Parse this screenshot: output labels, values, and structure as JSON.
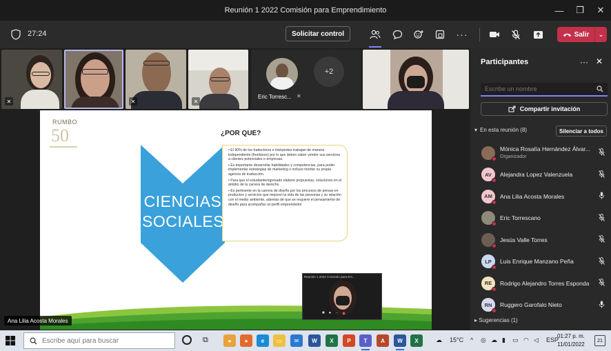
{
  "window": {
    "title": "Reunión 1 2022 Comisión para Emprendimiento",
    "minimize": "—",
    "maximize": "❐",
    "close": "✕"
  },
  "toolbar": {
    "timer": "27:24",
    "request_control": "Solicitar control",
    "leave_label": "Salir",
    "leave_caret": "⌄",
    "accent": "#7f85f5",
    "leave_color": "#c4314b"
  },
  "videos": {
    "avatar_name": "Eric Torresc...",
    "overflow_count": "+2"
  },
  "slide": {
    "logo_word": "RUMBO",
    "logo_number": "50",
    "heading": "¿POR QUE?",
    "chevron_text_line1": "CIENCIAS",
    "chevron_text_line2": "SOCIALES",
    "chevron_color": "#3aa1db",
    "bullets": [
      "El 90% de los traductores e intérpretes trabajan de manera independiente (freelance) por lo que deben saber vender sus servicios a clientes potenciales o empresas.",
      "Es importante desarrollar habilidades y competencias, para poder implementar estrategias de marketing o incluso montar su propia agencia de traducción.",
      "Para que el estudiante/egresado elabore propuestas, soluciones en el ámbito de la carrera de derecho",
      "Es pertinente en la carrera de diseño por los procesos de pensar en productos y servicios que mejoren la vida de las personas y su relación con el medio ambiente, además de que se requiere el pensamiento de diseño para acompañar un perfil emprendedor"
    ],
    "selfview_label": "Reunión 1 2022 Comisión para Em..."
  },
  "presenter_name": "Ana Lilia Acosta Morales",
  "panel": {
    "title": "Participantes",
    "more": "···",
    "close": "✕",
    "search_placeholder": "Escribe un nombre",
    "share_invite": "Compartir invitación",
    "section_label": "En esta reunión (8)",
    "mute_all": "Silenciar a todos",
    "participants": [
      {
        "name": "Mónica Rosalía Hernández Álvar...",
        "role": "Organizador",
        "initials": "",
        "photo": true,
        "color": "#8a6b55",
        "mic": "muted"
      },
      {
        "name": "Alejandra Lopez Valenzuela",
        "role": "",
        "initials": "AV",
        "photo": false,
        "color": "#f3c6cf",
        "mic": "muted"
      },
      {
        "name": "Ana Lilia Acosta Morales",
        "role": "",
        "initials": "AM",
        "photo": false,
        "color": "#f3c6cf",
        "mic": "on"
      },
      {
        "name": "Eric Torrescano",
        "role": "",
        "initials": "",
        "photo": true,
        "color": "#8f8a7a",
        "mic": "muted"
      },
      {
        "name": "Jesús Valle Torres",
        "role": "",
        "initials": "",
        "photo": true,
        "color": "#6b5f55",
        "mic": "muted"
      },
      {
        "name": "Luis Enrique Manzano Peña",
        "role": "",
        "initials": "LP",
        "photo": false,
        "color": "#c9d9f2",
        "mic": "muted"
      },
      {
        "name": "Rodrigo Alejandro Torres Esponda",
        "role": "",
        "initials": "RE",
        "photo": false,
        "color": "#f3e3c0",
        "mic": "muted"
      },
      {
        "name": "Ruggero Garofalo Nieto",
        "role": "",
        "initials": "RN",
        "photo": false,
        "color": "#d6d9ee",
        "mic": "on"
      }
    ],
    "suggestions": "Sugerencias (1)"
  },
  "taskbar": {
    "search_placeholder": "Escribe aquí para buscar",
    "weather": "15°C",
    "language": "ESP",
    "time": "01:27 p. m.",
    "date": "11/01/2022",
    "notifications": "21"
  }
}
